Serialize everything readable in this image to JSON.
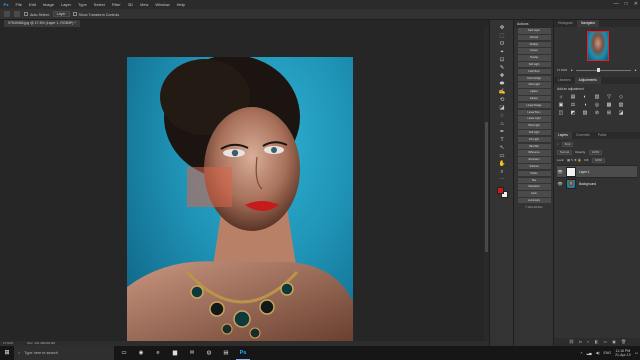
{
  "menu": {
    "logo": "Ps",
    "items": [
      "File",
      "Edit",
      "Image",
      "Layer",
      "Type",
      "Select",
      "Filter",
      "3D",
      "View",
      "Window",
      "Help"
    ],
    "window_controls": [
      "—",
      "□",
      "✕"
    ]
  },
  "options_bar": {
    "auto_select_label": "Auto-Select:",
    "auto_select_value": "Layer",
    "show_transform_label": "Show Transform Controls"
  },
  "document_tab": {
    "title": "97549456.jpg @ 17.6% (Layer 1, RGB/8*) *"
  },
  "status_bar": {
    "zoom": "17.62%",
    "doc_info": "Doc: 101.3M/202.6M"
  },
  "toolbar": {
    "tools": [
      "✥",
      "⬚",
      "ʘ",
      "⌖",
      "⊡",
      "✎",
      "✚",
      "⬬",
      "✍",
      "⟲",
      "◪",
      "♢",
      "⌂",
      "✒",
      "T",
      "↖",
      "▭",
      "✋",
      "⌕",
      "⋯"
    ]
  },
  "actions_panel": {
    "title": "Actions",
    "buttons": [
      "New Layer",
      "Normal",
      "Multiply",
      "Screen",
      "Overlay",
      "Soft Light",
      "Color Burn",
      "Color Dodge",
      "Vivid Light",
      "Lighten",
      "Darken",
      "Linear Dodge",
      "Linear Burn",
      "Linear Light",
      "Hard Light",
      "Soft Light",
      "Pin Light",
      "Hard Mix",
      "Difference",
      "Exclusion",
      "Subtract",
      "Divide",
      "Hue",
      "Saturation",
      "Color",
      "Luminosity"
    ],
    "footer": "© Web WinDer"
  },
  "navigator": {
    "tabs": [
      "Histogram",
      "Navigator"
    ],
    "active_tab": "Navigator",
    "zoom": "17.62%"
  },
  "adjustments": {
    "tabs": [
      "Libraries",
      "Adjustments"
    ],
    "active_tab": "Adjustments",
    "label": "Add an adjustment",
    "icons": [
      "☼",
      "▤",
      "◐",
      "▥",
      "▽",
      "◇",
      "▣",
      "⚖",
      "◑",
      "◎",
      "▦",
      "▧",
      "◫",
      "◩",
      "▨",
      "⊘",
      "⊞",
      "◪"
    ]
  },
  "layers": {
    "tabs": [
      "Layers",
      "Channels",
      "Paths"
    ],
    "active_tab": "Layers",
    "filter_label": "Kind",
    "blend_mode": "Normal",
    "opacity_label": "Opacity:",
    "opacity_value": "100%",
    "lock_label": "Lock:",
    "fill_label": "Fill:",
    "fill_value": "100%",
    "items": [
      {
        "name": "Layer 1",
        "visible": true,
        "active": true
      },
      {
        "name": "Background",
        "visible": true,
        "active": false
      }
    ],
    "footer_icons": [
      "⛓",
      "fx",
      "◐",
      "◧",
      "▭",
      "▣",
      "🗑"
    ]
  },
  "taskbar": {
    "start_icon": "⊞",
    "search_placeholder": "Type here to search",
    "apps": [
      "▭",
      "◉",
      "e",
      "▆",
      "✉",
      "◍",
      "▤",
      "Ps"
    ],
    "time": "11:16 PM",
    "date": "21-Apr-19",
    "language": "ENG"
  }
}
